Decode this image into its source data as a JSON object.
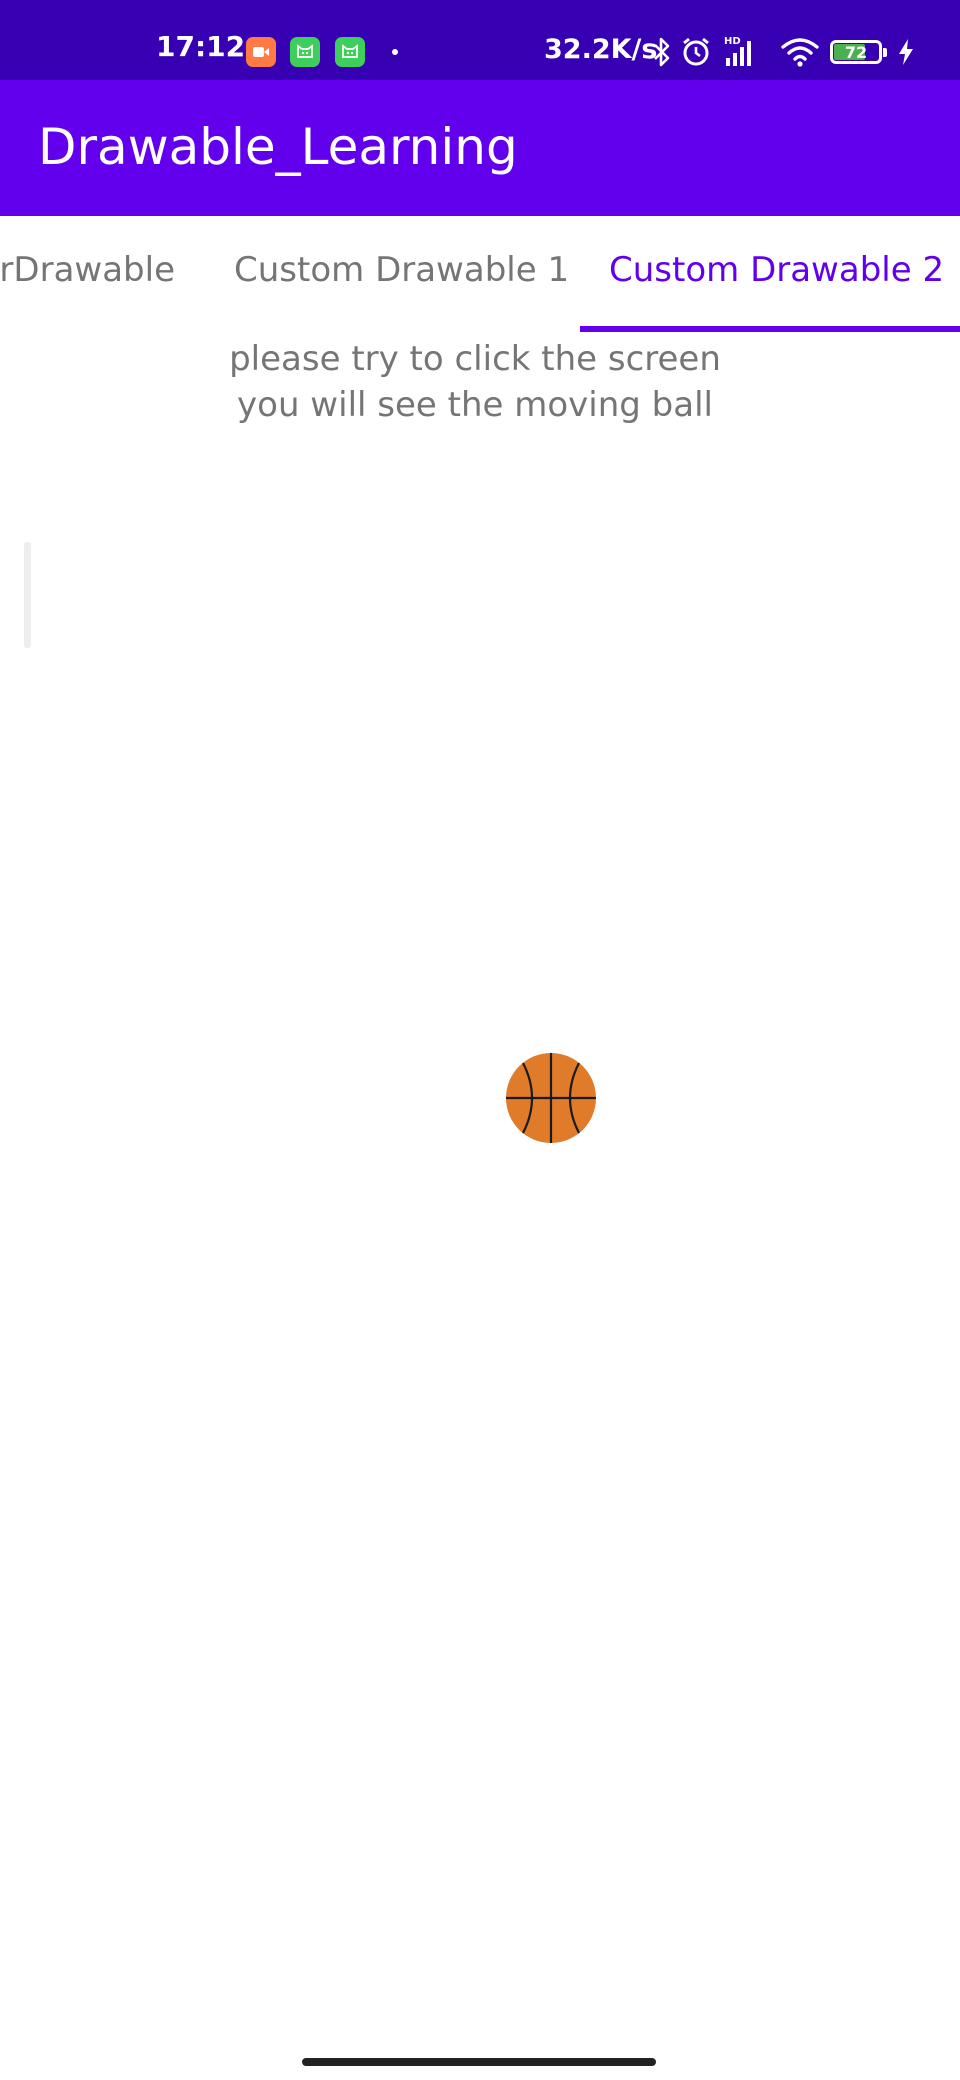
{
  "status_bar": {
    "time": "17:12",
    "net_speed": "32.2K/s",
    "battery_level": "72",
    "battery_fraction": 0.72,
    "notification_icons": [
      "video-call-icon",
      "cat-app-icon",
      "cat-app-icon"
    ],
    "system_icons": [
      "bluetooth-icon",
      "alarm-icon",
      "hd-signal-icon",
      "wifi-icon",
      "battery-icon",
      "charging-icon"
    ]
  },
  "app_bar": {
    "title": "Drawable_Learning"
  },
  "tabs": [
    {
      "label": "ColorDrawable"
    },
    {
      "label": "Custom Drawable 1"
    },
    {
      "label": "Custom Drawable 2",
      "selected": true
    }
  ],
  "hint": {
    "line1": "please try to click the screen",
    "line2": "you will see the moving ball"
  },
  "colors": {
    "status_bar": "#3700b3",
    "app_bar": "#6200ee",
    "accent": "#6200ee",
    "ball": "#e07b2a",
    "tab_text": "#757575"
  }
}
